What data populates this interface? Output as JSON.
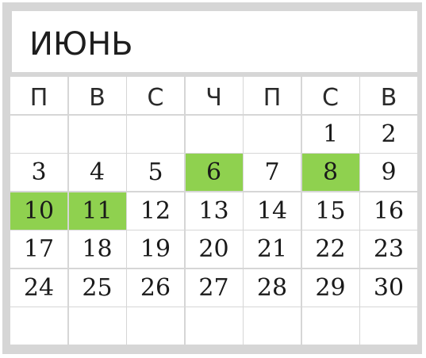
{
  "calendar": {
    "month": "ИЮНЬ",
    "weekdays": [
      "П",
      "В",
      "С",
      "Ч",
      "П",
      "С",
      "В"
    ],
    "weeks": [
      [
        {
          "d": "",
          "hl": false
        },
        {
          "d": "",
          "hl": false
        },
        {
          "d": "",
          "hl": false
        },
        {
          "d": "",
          "hl": false
        },
        {
          "d": "",
          "hl": false
        },
        {
          "d": "1",
          "hl": false
        },
        {
          "d": "2",
          "hl": false
        }
      ],
      [
        {
          "d": "3",
          "hl": false
        },
        {
          "d": "4",
          "hl": false
        },
        {
          "d": "5",
          "hl": false
        },
        {
          "d": "6",
          "hl": true
        },
        {
          "d": "7",
          "hl": false
        },
        {
          "d": "8",
          "hl": true
        },
        {
          "d": "9",
          "hl": false
        }
      ],
      [
        {
          "d": "10",
          "hl": true
        },
        {
          "d": "11",
          "hl": true
        },
        {
          "d": "12",
          "hl": false
        },
        {
          "d": "13",
          "hl": false
        },
        {
          "d": "14",
          "hl": false
        },
        {
          "d": "15",
          "hl": false
        },
        {
          "d": "16",
          "hl": false
        }
      ],
      [
        {
          "d": "17",
          "hl": false
        },
        {
          "d": "18",
          "hl": false
        },
        {
          "d": "19",
          "hl": false
        },
        {
          "d": "20",
          "hl": false
        },
        {
          "d": "21",
          "hl": false
        },
        {
          "d": "22",
          "hl": false
        },
        {
          "d": "23",
          "hl": false
        }
      ],
      [
        {
          "d": "24",
          "hl": false
        },
        {
          "d": "25",
          "hl": false
        },
        {
          "d": "26",
          "hl": false
        },
        {
          "d": "27",
          "hl": false
        },
        {
          "d": "28",
          "hl": false
        },
        {
          "d": "29",
          "hl": false
        },
        {
          "d": "30",
          "hl": false
        }
      ],
      [
        {
          "d": "",
          "hl": false
        },
        {
          "d": "",
          "hl": false
        },
        {
          "d": "",
          "hl": false
        },
        {
          "d": "",
          "hl": false
        },
        {
          "d": "",
          "hl": false
        },
        {
          "d": "",
          "hl": false
        },
        {
          "d": "",
          "hl": false
        }
      ]
    ]
  },
  "colors": {
    "frame": "#d6d6d6",
    "highlight": "#8fd14f",
    "cell": "#ffffff",
    "text": "#1a1a1a"
  }
}
